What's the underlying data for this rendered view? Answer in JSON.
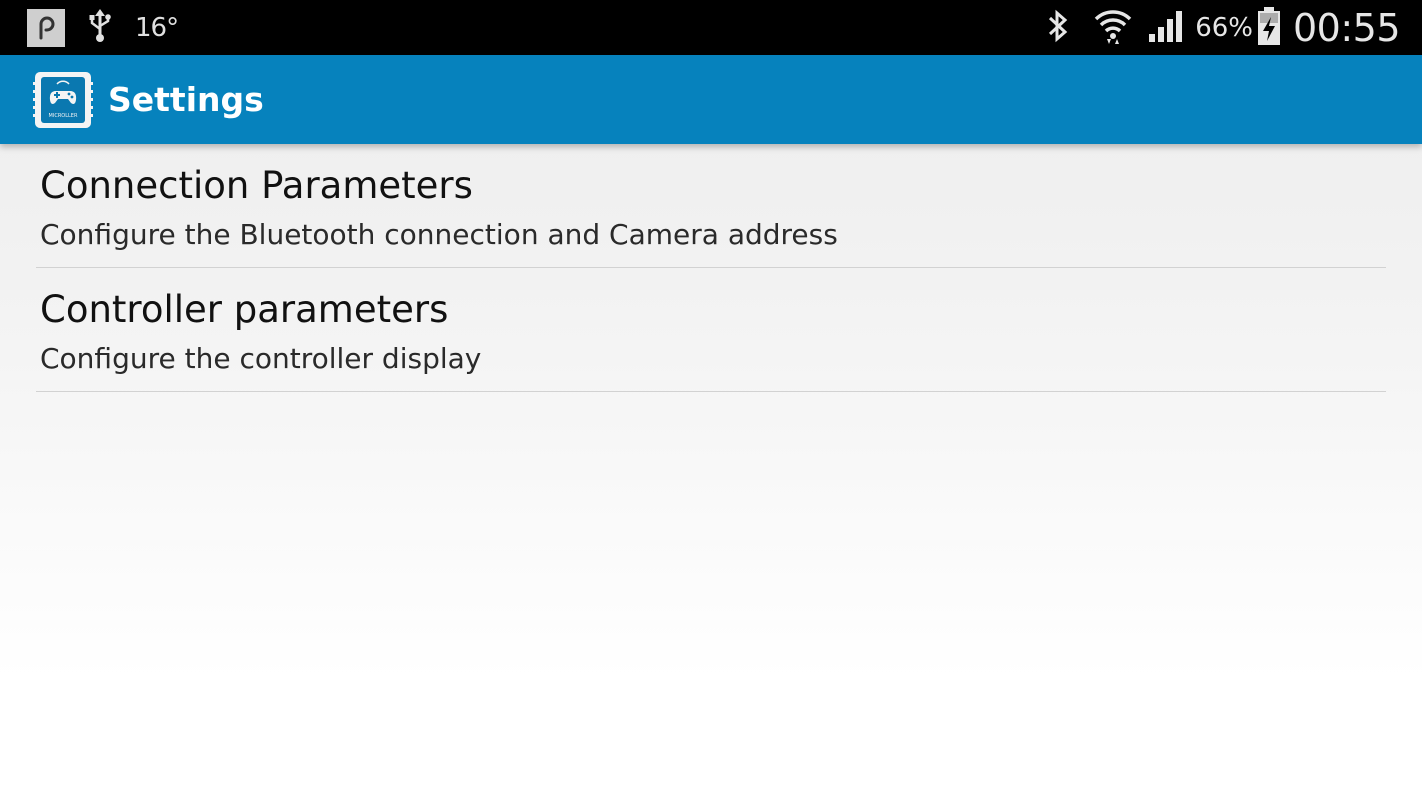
{
  "status_bar": {
    "notification_icons": [
      "p-notification-icon",
      "usb-icon"
    ],
    "temperature": "16°",
    "status_icons": [
      "bluetooth-icon",
      "wifi-icon",
      "signal-icon",
      "battery-charging-icon"
    ],
    "battery_percent": "66%",
    "time": "00:55"
  },
  "action_bar": {
    "title": "Settings",
    "app_icon": "microller-app-icon",
    "app_icon_text": "MICROLLER",
    "color": "#0682bd"
  },
  "preferences": [
    {
      "title": "Connection Parameters",
      "summary": "Configure the Bluetooth connection and Camera address"
    },
    {
      "title": "Controller parameters",
      "summary": "Configure the controller display"
    }
  ]
}
